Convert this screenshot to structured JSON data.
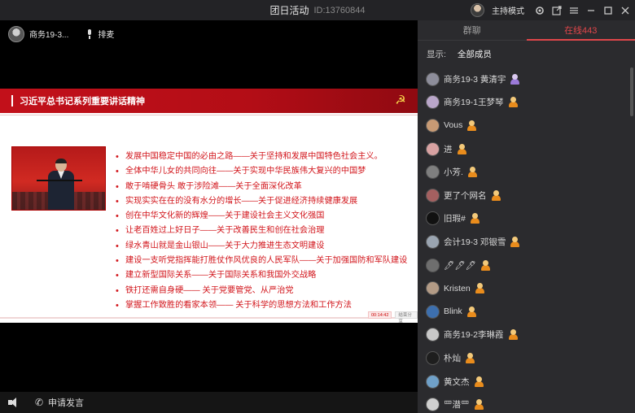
{
  "window": {
    "title": "团日活动",
    "room_id": "ID:13760844",
    "host_mode_label": "主持模式",
    "icons": [
      "host-avatar",
      "settings-icon",
      "popout-icon",
      "menu-icon",
      "minimize-icon",
      "maximize-icon",
      "close-icon"
    ]
  },
  "video": {
    "presenter_name": "商务19-3...",
    "queue_label": "排麦"
  },
  "slide": {
    "title": "习近平总书记系列重要讲话精神",
    "bullets": [
      "发展中国稳定中国的必由之路——关于坚持和发展中国特色社会主义。",
      "全体中华儿女的共同向往——关于实现中华民族伟大复兴的中国梦",
      "敢于啃硬骨头 敢于涉险滩——关于全面深化改革",
      "实现实实在在的没有水分的增长——关于促进经济持续健康发展",
      "创在中华文化新的辉煌——关于建设社会主义文化强国",
      "让老百姓过上好日子——关于改善民生和创在社会治理",
      "绿水青山就是金山银山——关于大力推进生态文明建设",
      "建设一支听党指挥能打胜仗作风优良的人民军队——关于加强国防和军队建设",
      "建立新型国际关系——关于国际关系和我国外交战略",
      "铁打还需自身硬—— 关于党要管党、从严治党",
      "掌握工作致胜的看家本领—— 关于科学的思想方法和工作方法"
    ],
    "timer_text": "00:14:42",
    "share_text": "结束分享"
  },
  "bottom": {
    "request_speak_label": "申请发言"
  },
  "panel": {
    "tabs": [
      {
        "label": "群聊",
        "active": false
      },
      {
        "label": "在线443",
        "active": true
      }
    ],
    "filter_label": "显示:",
    "filter_value": "全部成员",
    "members": [
      {
        "name": "商务19-3 黄清宇",
        "avatar_color": "#8d8d9a",
        "role": "host"
      },
      {
        "name": "商务19-1王梦琴",
        "avatar_color": "#b9a6c9",
        "role": "member"
      },
      {
        "name": "Vous",
        "avatar_color": "#c79a74",
        "role": "member"
      },
      {
        "name": "进",
        "avatar_color": "#d8a2a2",
        "role": "member"
      },
      {
        "name": "小芳.",
        "avatar_color": "#7f7f7f",
        "role": "member"
      },
      {
        "name": "更了个网名",
        "avatar_color": "#a46060",
        "role": "member"
      },
      {
        "name": "旧瑕#",
        "avatar_color": "#111111",
        "role": "member"
      },
      {
        "name": "会计19-3 邓银雪",
        "avatar_color": "#9aa4b0",
        "role": "member"
      },
      {
        "name": "🖊🖊🖊",
        "avatar_color": "#6e6e6e",
        "role": "member"
      },
      {
        "name": "Kristen",
        "avatar_color": "#b39b86",
        "role": "member"
      },
      {
        "name": "Blink",
        "avatar_color": "#3d6fae",
        "role": "member"
      },
      {
        "name": "商务19-2李琳霞",
        "avatar_color": "#c8c8c8",
        "role": "member"
      },
      {
        "name": "朴灿",
        "avatar_color": "#1e1e1e",
        "role": "member"
      },
      {
        "name": "黄文杰",
        "avatar_color": "#6fa0c8",
        "role": "member"
      },
      {
        "name": "罒潜罒",
        "avatar_color": "#cfcfcf",
        "role": "member"
      }
    ]
  }
}
